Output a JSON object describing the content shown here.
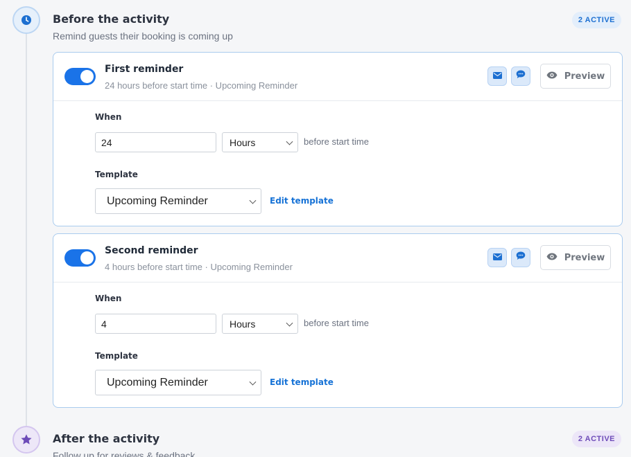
{
  "before": {
    "title": "Before the activity",
    "subtitle": "Remind guests their booking is coming up",
    "badge": "2 ACTIVE",
    "icon": "clock-icon"
  },
  "after": {
    "title": "After the activity",
    "subtitle": "Follow up for reviews & feedback",
    "badge": "2 ACTIVE",
    "icon": "star-icon"
  },
  "reminders": [
    {
      "title": "First reminder",
      "subtitle": "24 hours before start time · Upcoming Reminder",
      "enabled": true,
      "preview_label": "Preview",
      "when_label": "When",
      "amount": "24",
      "unit": "Hours",
      "after_text": "before start time",
      "template_label": "Template",
      "template": "Upcoming Reminder",
      "edit_label": "Edit template"
    },
    {
      "title": "Second reminder",
      "subtitle": "4 hours before start time · Upcoming Reminder",
      "enabled": true,
      "preview_label": "Preview",
      "when_label": "When",
      "amount": "4",
      "unit": "Hours",
      "after_text": "before start time",
      "template_label": "Template",
      "template": "Upcoming Reminder",
      "edit_label": "Edit template"
    }
  ],
  "colors": {
    "accent": "#1a73e8",
    "after_accent": "#6d4bb8",
    "card_border": "#a9cbee"
  }
}
